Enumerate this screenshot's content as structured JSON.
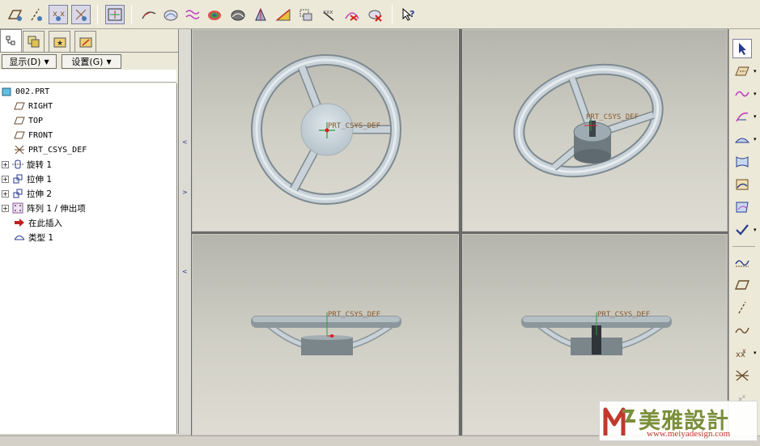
{
  "toolbar": {
    "icons": [
      "datum-plane-display-icon",
      "datum-axis-display-icon",
      "point-display-icon",
      "csys-display-icon",
      "spin-center-icon",
      "curve-analysis-icon",
      "surface-analysis-icon",
      "dihedral-icon",
      "curvature-icon",
      "shade-icon",
      "draft-icon",
      "slope-icon",
      "offset-icon",
      "deviation-icon",
      "reflection-icon",
      "whats-this-icon"
    ]
  },
  "left_panel": {
    "tabs": [
      "model-tree-tab",
      "layer-tree-tab",
      "favorites-tab",
      "connections-tab"
    ],
    "display_menu": "显示(D)",
    "settings_menu": "设置(G)"
  },
  "tree": {
    "items": [
      {
        "label": "002.PRT",
        "icon": "part-icon",
        "expander": false
      },
      {
        "label": "RIGHT",
        "icon": "datum-plane-icon",
        "expander": false
      },
      {
        "label": "TOP",
        "icon": "datum-plane-icon",
        "expander": false
      },
      {
        "label": "FRONT",
        "icon": "datum-plane-icon",
        "expander": false
      },
      {
        "label": "PRT_CSYS_DEF",
        "icon": "csys-icon",
        "expander": false
      },
      {
        "label": "旋转 1",
        "icon": "revolve-icon",
        "expander": true
      },
      {
        "label": "拉伸 1",
        "icon": "extrude-icon",
        "expander": true
      },
      {
        "label": "拉伸 2",
        "icon": "extrude-icon",
        "expander": true
      },
      {
        "label": "阵列 1 / 伸出项",
        "icon": "pattern-icon",
        "expander": true
      },
      {
        "label": "在此插入",
        "icon": "insert-here-arrow-icon",
        "expander": false
      },
      {
        "label": "类型 1",
        "icon": "style-feature-icon",
        "expander": false
      }
    ]
  },
  "viewports": {
    "csys_label": "PRT_CSYS_DEF",
    "names": [
      "front-view",
      "default-view",
      "top-view",
      "right-view"
    ]
  },
  "right_toolbar": {
    "icons": [
      "select-arrow-icon",
      "sketch-plane-icon",
      "curve-icon",
      "circle-curve-icon",
      "surface-icon",
      "boundary-surface-icon",
      "trim-icon",
      "curve-on-surface-icon",
      "done-check-icon",
      "datum-curve-icon",
      "datum-plane-icon",
      "datum-axis-icon",
      "datum-curve-sketch-icon",
      "datum-point-icon",
      "csys-icon",
      "point-offset-icon"
    ]
  },
  "colors": {
    "wheel": "#c5d0d6",
    "wheel_edge": "#6e7a80",
    "csys_green": "#2ca02c",
    "csys_red": "#d62020",
    "logo_green": "#7a8f3a",
    "logo_red": "#c0392b"
  },
  "logo": {
    "text": "美雅設計",
    "url": "www.meiyadesign.com"
  }
}
